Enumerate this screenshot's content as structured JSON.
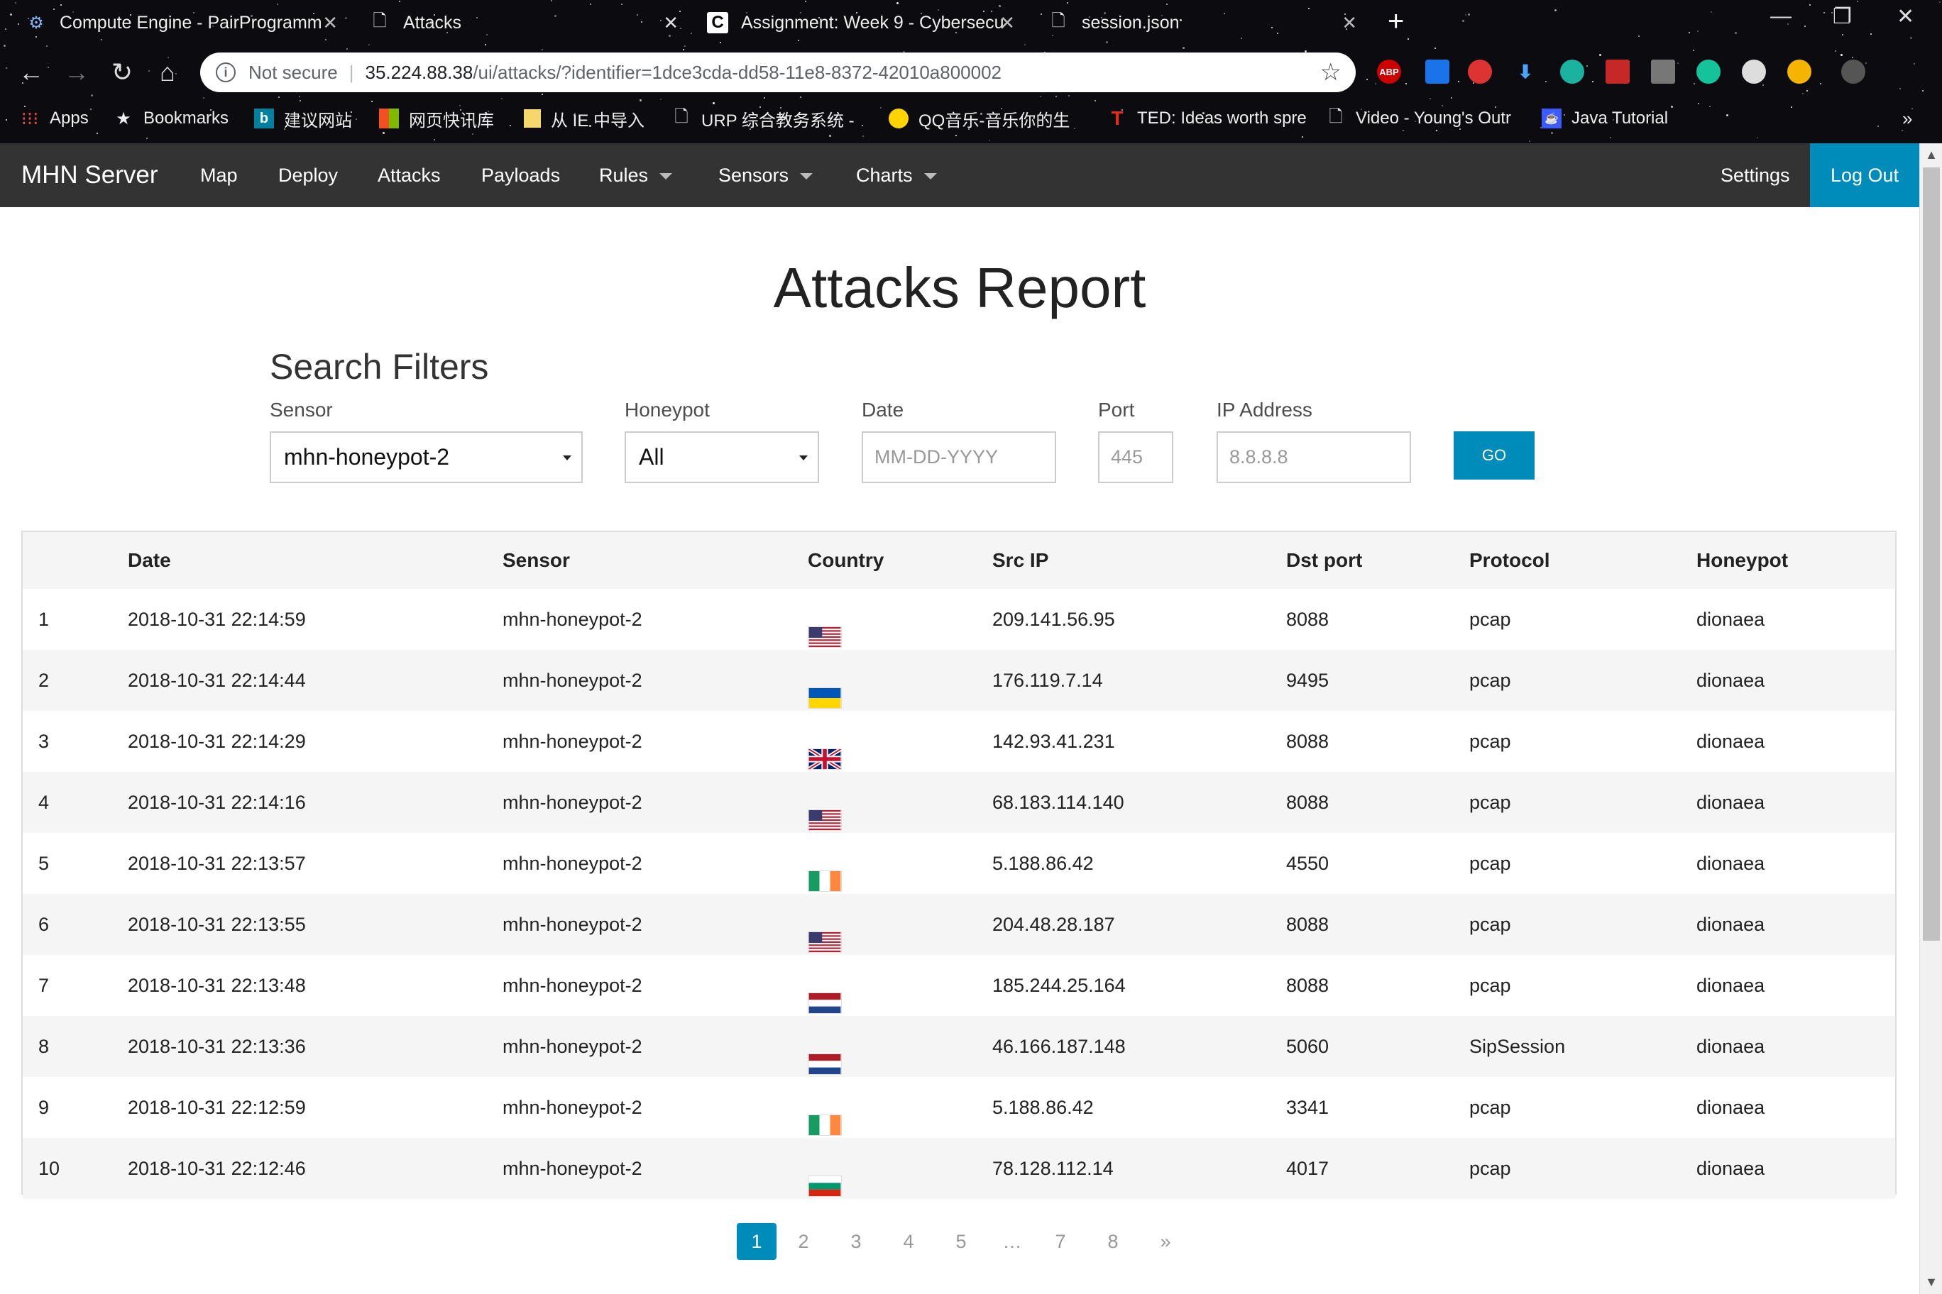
{
  "browser": {
    "tabs": [
      {
        "title": "Compute Engine - PairProgramm",
        "icon": "chip-icon"
      },
      {
        "title": "Attacks",
        "icon": "document-icon"
      },
      {
        "title": "Assignment: Week 9 - Cybersecu",
        "icon": "coursera-icon"
      },
      {
        "title": "session.json",
        "icon": "document-icon"
      }
    ],
    "address": {
      "security_label": "Not secure",
      "host": "35.224.88.38",
      "path": "/ui/attacks/?identifier=1dce3cda-dd58-11e8-8372-42010a800002"
    },
    "bookmarks": [
      {
        "label": "Apps",
        "icon": "apps-grid-icon"
      },
      {
        "label": "Bookmarks",
        "icon": "star-icon"
      },
      {
        "label": "建议网站",
        "icon": "bing-icon"
      },
      {
        "label": "网页快讯库",
        "icon": "windows-icon"
      },
      {
        "label": "从 IE 中导入",
        "icon": "folder-icon"
      },
      {
        "label": "URP 综合教务系统 -",
        "icon": "document-icon"
      },
      {
        "label": "QQ音乐-音乐你的生",
        "icon": "qq-music-icon"
      },
      {
        "label": "TED: Ideas worth spre",
        "icon": "ted-icon"
      },
      {
        "label": "Video - Young's Outr",
        "icon": "document-icon"
      },
      {
        "label": "Java Tutorial",
        "icon": "java-icon"
      }
    ],
    "extensions": [
      "ABP",
      "",
      "",
      "",
      "",
      "",
      "",
      "",
      "",
      ""
    ]
  },
  "navbar": {
    "brand": "MHN Server",
    "items": [
      {
        "label": "Map",
        "dropdown": false
      },
      {
        "label": "Deploy",
        "dropdown": false
      },
      {
        "label": "Attacks",
        "dropdown": false
      },
      {
        "label": "Payloads",
        "dropdown": false
      },
      {
        "label": "Rules",
        "dropdown": true
      },
      {
        "label": "Sensors",
        "dropdown": true
      },
      {
        "label": "Charts",
        "dropdown": true
      }
    ],
    "settings": "Settings",
    "logout": "Log Out",
    "accent_color": "#008cba"
  },
  "page": {
    "title": "Attacks Report"
  },
  "filters": {
    "heading": "Search Filters",
    "sensor": {
      "label": "Sensor",
      "value": "mhn-honeypot-2"
    },
    "honeypot": {
      "label": "Honeypot",
      "value": "All"
    },
    "date": {
      "label": "Date",
      "placeholder": "MM-DD-YYYY"
    },
    "port": {
      "label": "Port",
      "placeholder": "445"
    },
    "ip": {
      "label": "IP Address",
      "placeholder": "8.8.8.8"
    },
    "go": "GO"
  },
  "table": {
    "headers": [
      "",
      "Date",
      "Sensor",
      "Country",
      "Src IP",
      "Dst port",
      "Protocol",
      "Honeypot"
    ],
    "rows": [
      {
        "n": "1",
        "date": "2018-10-31 22:14:59",
        "sensor": "mhn-honeypot-2",
        "country": "us",
        "src_ip": "209.141.56.95",
        "dst_port": "8088",
        "protocol": "pcap",
        "honeypot": "dionaea"
      },
      {
        "n": "2",
        "date": "2018-10-31 22:14:44",
        "sensor": "mhn-honeypot-2",
        "country": "ua",
        "src_ip": "176.119.7.14",
        "dst_port": "9495",
        "protocol": "pcap",
        "honeypot": "dionaea"
      },
      {
        "n": "3",
        "date": "2018-10-31 22:14:29",
        "sensor": "mhn-honeypot-2",
        "country": "gb",
        "src_ip": "142.93.41.231",
        "dst_port": "8088",
        "protocol": "pcap",
        "honeypot": "dionaea"
      },
      {
        "n": "4",
        "date": "2018-10-31 22:14:16",
        "sensor": "mhn-honeypot-2",
        "country": "us",
        "src_ip": "68.183.114.140",
        "dst_port": "8088",
        "protocol": "pcap",
        "honeypot": "dionaea"
      },
      {
        "n": "5",
        "date": "2018-10-31 22:13:57",
        "sensor": "mhn-honeypot-2",
        "country": "ie",
        "src_ip": "5.188.86.42",
        "dst_port": "4550",
        "protocol": "pcap",
        "honeypot": "dionaea"
      },
      {
        "n": "6",
        "date": "2018-10-31 22:13:55",
        "sensor": "mhn-honeypot-2",
        "country": "us",
        "src_ip": "204.48.28.187",
        "dst_port": "8088",
        "protocol": "pcap",
        "honeypot": "dionaea"
      },
      {
        "n": "7",
        "date": "2018-10-31 22:13:48",
        "sensor": "mhn-honeypot-2",
        "country": "nl",
        "src_ip": "185.244.25.164",
        "dst_port": "8088",
        "protocol": "pcap",
        "honeypot": "dionaea"
      },
      {
        "n": "8",
        "date": "2018-10-31 22:13:36",
        "sensor": "mhn-honeypot-2",
        "country": "nl",
        "src_ip": "46.166.187.148",
        "dst_port": "5060",
        "protocol": "SipSession",
        "honeypot": "dionaea"
      },
      {
        "n": "9",
        "date": "2018-10-31 22:12:59",
        "sensor": "mhn-honeypot-2",
        "country": "ie",
        "src_ip": "5.188.86.42",
        "dst_port": "3341",
        "protocol": "pcap",
        "honeypot": "dionaea"
      },
      {
        "n": "10",
        "date": "2018-10-31 22:12:46",
        "sensor": "mhn-honeypot-2",
        "country": "bg",
        "src_ip": "78.128.112.14",
        "dst_port": "4017",
        "protocol": "pcap",
        "honeypot": "dionaea"
      }
    ]
  },
  "pagination": {
    "pages": [
      "1",
      "2",
      "3",
      "4",
      "5",
      "…",
      "7",
      "8",
      "»"
    ],
    "current": "1"
  }
}
